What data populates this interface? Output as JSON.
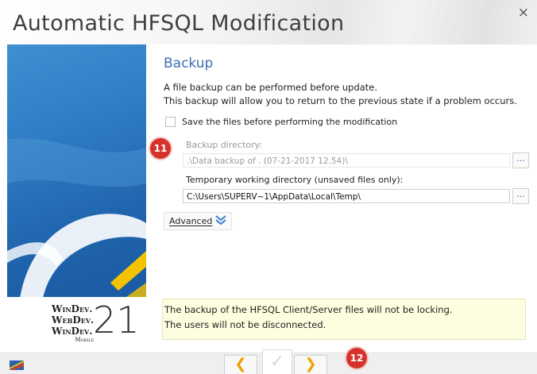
{
  "window": {
    "title": "Automatic HFSQL Modification",
    "close_symbol": "×"
  },
  "sidebar": {
    "logo_lines": [
      "WinDev.",
      "WebDev.",
      "WinDev."
    ],
    "logo_sub": "Mobile",
    "version": "21"
  },
  "section": {
    "title": "Backup",
    "description_1": "A file backup can be performed before update.",
    "description_2": "This backup will allow you to return to the previous state if a problem occurs."
  },
  "save_checkbox": {
    "label": "Save the files before performing the modification",
    "checked": false
  },
  "backup_dir": {
    "label": "Backup directory:",
    "value": ".\\Data backup of . (07-21-2017 12.54)\\",
    "disabled": true,
    "browse_label": "..."
  },
  "temp_dir": {
    "label": "Temporary working directory (unsaved files only):",
    "value": "C:\\Users\\SUPERV~1\\AppData\\Local\\Temp\\",
    "browse_label": "..."
  },
  "advanced_button": {
    "label": "Advanced",
    "icon": "chevron-double-down-icon"
  },
  "info": {
    "line_1": "The backup of the HFSQL Client/Server files will not be locking.",
    "line_2": "The users will not be disconnected."
  },
  "badges": {
    "badge_11": "11",
    "badge_12": "12"
  },
  "footer": {
    "prev_symbol": "❮",
    "next_symbol": "❯",
    "validate_symbol": "✓"
  },
  "colors": {
    "accent": "#3b6eb4",
    "badge": "#d6322c",
    "info_bg": "#fdfde0",
    "nav_arrow": "#f0a000"
  }
}
